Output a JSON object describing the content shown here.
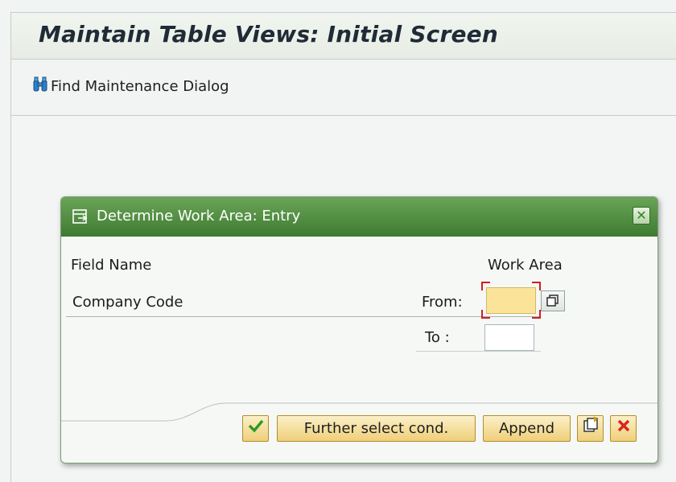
{
  "window": {
    "title": "Maintain Table Views: Initial Screen"
  },
  "toolbar": {
    "find_label": "Find Maintenance Dialog",
    "find_icon": "binoculars-icon"
  },
  "dialog": {
    "title": "Determine Work Area: Entry",
    "title_icon": "entry-dialog-icon",
    "close_icon": "close-icon",
    "columns": {
      "field_name": "Field Name",
      "work_area": "Work Area"
    },
    "row": {
      "field": "Company Code",
      "from_label": "From:",
      "to_label": "To :",
      "from_value": "",
      "to_value": ""
    },
    "buttons": {
      "continue_icon": "checkmark-icon",
      "further_select": "Further select cond.",
      "append": "Append",
      "new_entries_icon": "new-entries-icon",
      "cancel_icon": "cancel-icon"
    }
  },
  "colors": {
    "header_green": "#3e7b31",
    "button_yellow": "#efcf79",
    "focus_field": "#fbe49a",
    "focus_marker": "#d21f1f"
  }
}
